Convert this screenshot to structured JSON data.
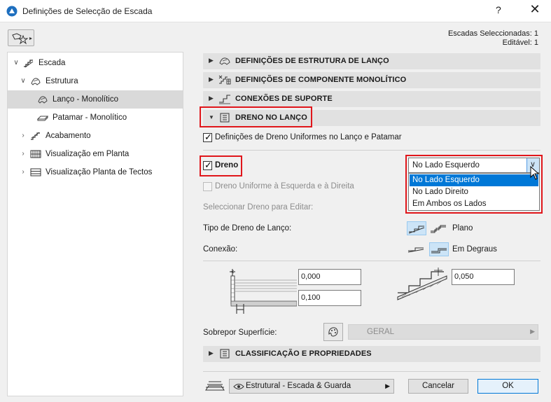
{
  "window": {
    "title": "Definições de Selecção de Escada",
    "help_label": "?",
    "close_label": "✕"
  },
  "selection": {
    "selected": "Escadas Seleccionadas: 1",
    "editable": "Editável: 1"
  },
  "tree": {
    "items": [
      {
        "label": "Escada",
        "expanded": true
      },
      {
        "label": "Estrutura",
        "expanded": true
      },
      {
        "label": "Lanço - Monolítico",
        "selected": true
      },
      {
        "label": "Patamar - Monolítico"
      },
      {
        "label": "Acabamento",
        "expanded": false
      },
      {
        "label": "Visualização em Planta",
        "expanded": false
      },
      {
        "label": "Visualização Planta de Tectos",
        "expanded": false
      }
    ]
  },
  "sections": {
    "s1": "DEFINIÇÕES DE ESTRUTURA DE LANÇO",
    "s2": "DEFINIÇÕES DE COMPONENTE MONOLÍTICO",
    "s3": "CONEXÕES DE SUPORTE",
    "s4": "DRENO NO LANÇO",
    "s5": "CLASSIFICAÇÃO E PROPRIEDADES"
  },
  "drain": {
    "uniform_label": "Definições de Dreno Uniformes no Lanço e Patamar",
    "dreno_label": "Dreno",
    "side_selected": "No Lado Esquerdo",
    "side_options": [
      "No Lado Esquerdo",
      "No Lado Direito",
      "Em Ambos os Lados"
    ],
    "uniform_lr_label": "Dreno Uniforme à Esquerda e à Direita",
    "select_edit_label": "Seleccionar Dreno para Editar:",
    "type_label": "Tipo de Dreno de Lanço:",
    "type_value": "Plano",
    "connection_label": "Conexão:",
    "connection_value": "Em Degraus",
    "value1": "0,000",
    "value2": "0,100",
    "value3": "0,050",
    "override_label": "Sobrepor Superfície:",
    "surface_value": "GERAL"
  },
  "footer": {
    "favorite_value": "Estrutural - Escada & Guarda",
    "cancel_label": "Cancelar",
    "ok_label": "OK"
  },
  "colors": {
    "highlight": "#0078d7",
    "annotation_red": "#e0161b"
  }
}
